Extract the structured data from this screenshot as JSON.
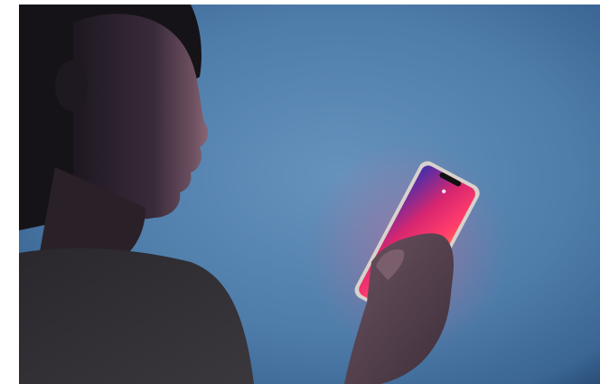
{
  "image": {
    "subject": "person-looking-at-phone",
    "colors": {
      "background": "#4d7aa6",
      "background_light": "#5f8db8",
      "vignette": "#203a5c",
      "skin_shadow": "#2a2230",
      "skin_light": "#7a5a6a",
      "shirt": "#2c2a2f",
      "hair": "#161318",
      "phone_frame": "#d9d4d0",
      "screen_pink": "#ff2f6e",
      "screen_purple": "#5a3cc8",
      "screen_orange": "#ff7a3a"
    }
  }
}
